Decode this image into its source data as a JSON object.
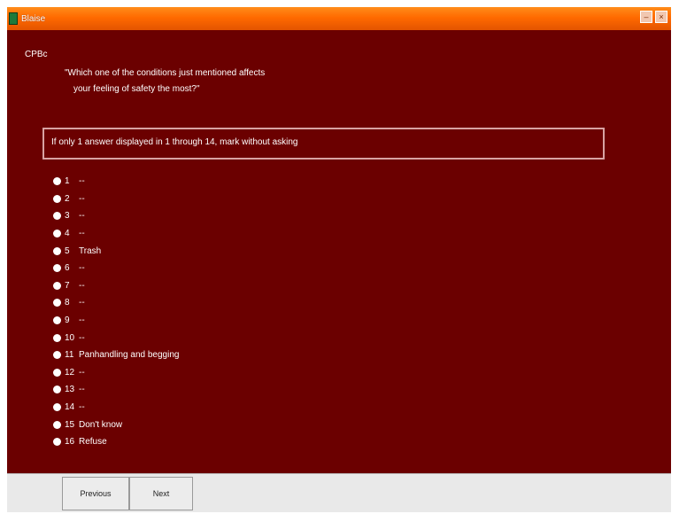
{
  "window": {
    "title": "Blaise"
  },
  "question": {
    "id": "CPBc",
    "text_line1": "\"Which one of the conditions just mentioned affects",
    "text_line2": "your feeling of safety the most?\""
  },
  "instruction": "If only 1 answer displayed in 1 through 14, mark without asking",
  "options": [
    {
      "num": "1",
      "label": "--"
    },
    {
      "num": "2",
      "label": "--"
    },
    {
      "num": "3",
      "label": "--"
    },
    {
      "num": "4",
      "label": "--"
    },
    {
      "num": "5",
      "label": "Trash"
    },
    {
      "num": "6",
      "label": "--"
    },
    {
      "num": "7",
      "label": "--"
    },
    {
      "num": "8",
      "label": "--"
    },
    {
      "num": "9",
      "label": "--"
    },
    {
      "num": "10",
      "label": "--"
    },
    {
      "num": "11",
      "label": "Panhandling and begging"
    },
    {
      "num": "12",
      "label": "--"
    },
    {
      "num": "13",
      "label": "--"
    },
    {
      "num": "14",
      "label": "--"
    },
    {
      "num": "15",
      "label": "Don't know"
    },
    {
      "num": "16",
      "label": "Refuse"
    }
  ],
  "buttons": {
    "previous": "Previous",
    "next": "Next"
  },
  "colors": {
    "background": "#6b0000",
    "titlebar": "#ff6a00",
    "text": "#ffffff",
    "buttonbar": "#e9e9e9"
  }
}
